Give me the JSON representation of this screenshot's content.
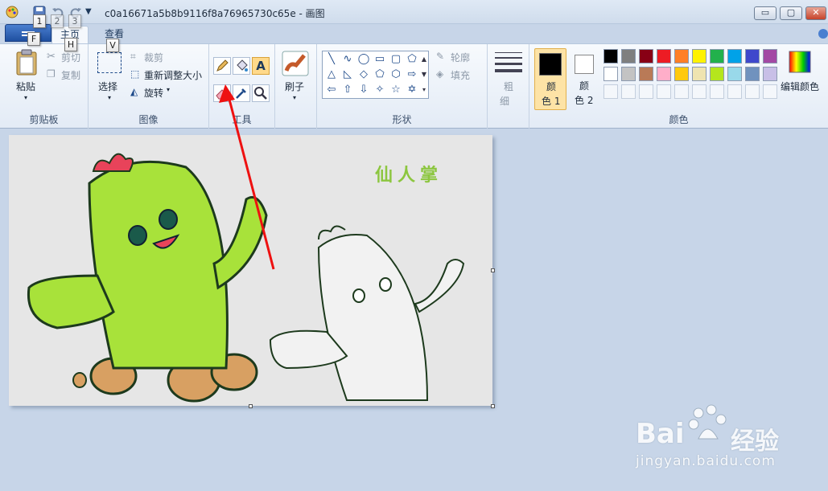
{
  "window": {
    "title": "c0a16671a5b8b9116f8a76965730c65e - 画图",
    "min_label": "▭",
    "max_label": "▢",
    "close_label": "✕"
  },
  "keytips": {
    "f": "F",
    "one": "1",
    "two": "2",
    "three": "3",
    "h": "H",
    "v": "V"
  },
  "tabs": {
    "home": "主页",
    "view": "查看"
  },
  "clipboard": {
    "paste": "粘贴",
    "cut": "剪切",
    "copy": "复制",
    "group": "剪贴板"
  },
  "image": {
    "select": "选择",
    "crop": "裁剪",
    "resize": "重新调整大小",
    "rotate": "旋转",
    "group": "图像"
  },
  "tools": {
    "group": "工具",
    "selected": "eraser-tool"
  },
  "brushes": {
    "label": "刷子"
  },
  "shapes": {
    "outline": "轮廓",
    "fill": "填充",
    "group": "形状"
  },
  "size": {
    "label1": "粗",
    "label2": "细"
  },
  "colors": {
    "color1_a": "颜",
    "color1_b": "色 1",
    "color2_a": "颜",
    "color2_b": "色 2",
    "edit": "编辑颜色",
    "group": "颜色",
    "color1": "#000000",
    "color2": "#ffffff",
    "palette_row1": [
      "#000000",
      "#7f7f7f",
      "#880015",
      "#ed1c24",
      "#ff7f27",
      "#fff200",
      "#22b14c",
      "#00a2e8",
      "#3f48cc",
      "#a349a4"
    ],
    "palette_row2": [
      "#ffffff",
      "#c3c3c3",
      "#b97a57",
      "#ffaec9",
      "#ffc90e",
      "#efe4b0",
      "#b5e61d",
      "#99d9ea",
      "#7092be",
      "#c8bfe7"
    ]
  },
  "canvas_text": {
    "title": "仙人掌"
  },
  "watermark": {
    "brand": "Bai",
    "brand2": "经验",
    "url": "jingyan.baidu.com"
  }
}
